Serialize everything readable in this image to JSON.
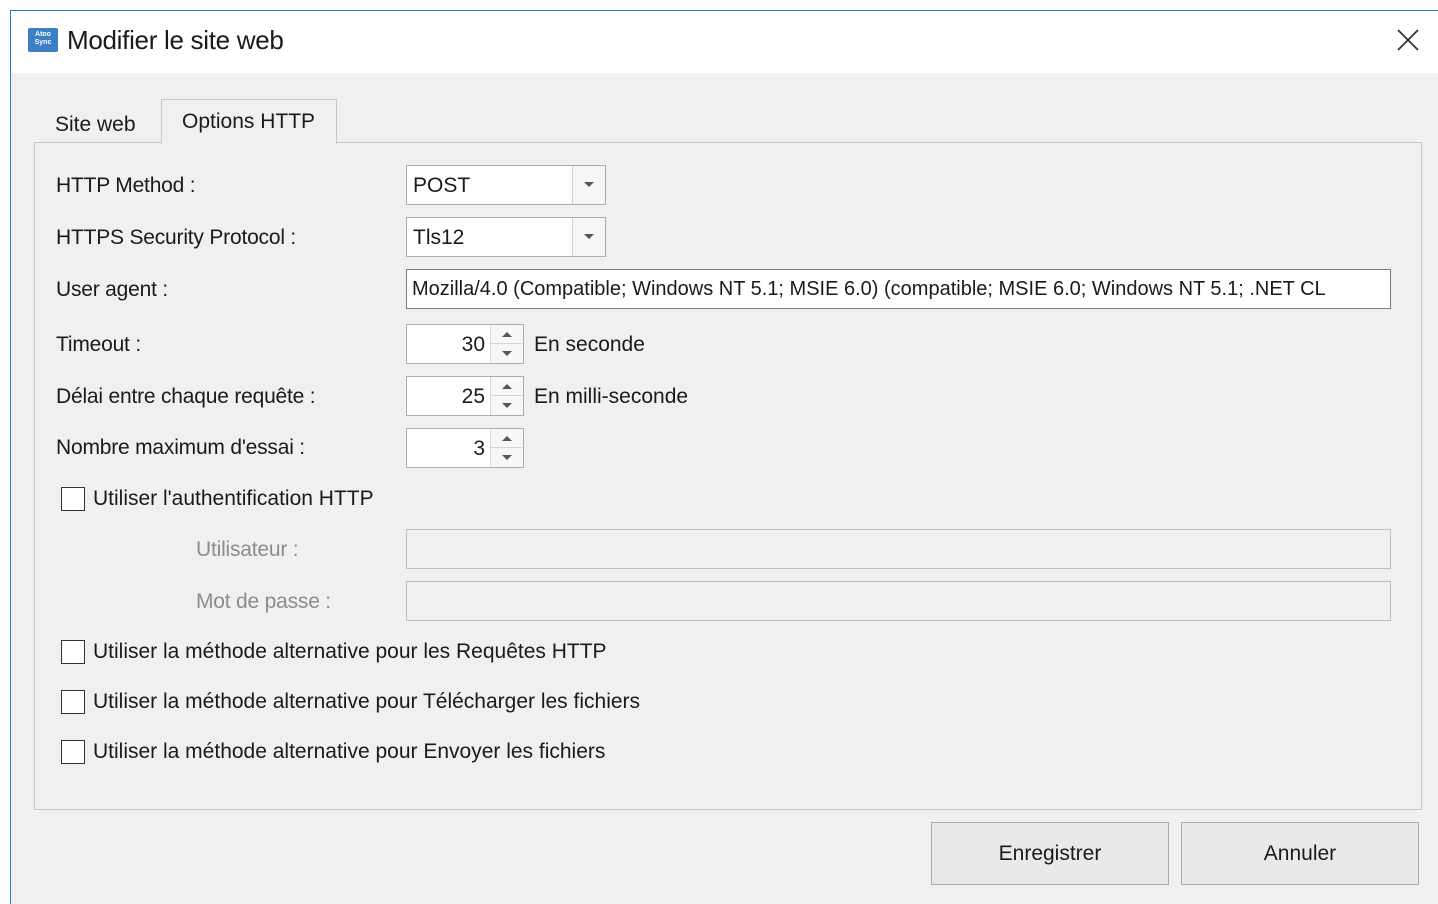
{
  "window": {
    "title": "Modifier le site web",
    "app_icon_text": [
      "Atoo",
      "Sync"
    ],
    "close_icon": "close-icon"
  },
  "tabs": [
    {
      "label": "Site web",
      "active": false
    },
    {
      "label": "Options HTTP",
      "active": true
    }
  ],
  "form": {
    "http_method": {
      "label": "HTTP Method :",
      "value": "POST"
    },
    "https_protocol": {
      "label": "HTTPS Security Protocol :",
      "value": "Tls12"
    },
    "user_agent": {
      "label": "User agent :",
      "value": "Mozilla/4.0 (Compatible; Windows NT 5.1; MSIE 6.0) (compatible; MSIE 6.0; Windows NT 5.1; .NET CL"
    },
    "timeout": {
      "label": "Timeout :",
      "value": "30",
      "unit": "En seconde"
    },
    "delay": {
      "label": "Délai entre chaque requête :",
      "value": "25",
      "unit": "En milli-seconde"
    },
    "max_tries": {
      "label": "Nombre maximum d'essai :",
      "value": "3"
    },
    "use_http_auth": {
      "label": "Utiliser l'authentification HTTP",
      "checked": false
    },
    "username": {
      "label": "Utilisateur :",
      "value": ""
    },
    "password": {
      "label": "Mot de passe :",
      "value": ""
    },
    "alt_http_requests": {
      "label": "Utiliser la méthode alternative pour les Requêtes HTTP",
      "checked": false
    },
    "alt_download": {
      "label": "Utiliser la méthode alternative pour Télécharger les fichiers",
      "checked": false
    },
    "alt_upload": {
      "label": "Utiliser la méthode alternative pour Envoyer les fichiers",
      "checked": false
    }
  },
  "buttons": {
    "save": "Enregistrer",
    "cancel": "Annuler"
  },
  "colors": {
    "window_border": "#2b79d0",
    "background": "#f0f0f0",
    "disabled_text": "#8c8c8c"
  }
}
